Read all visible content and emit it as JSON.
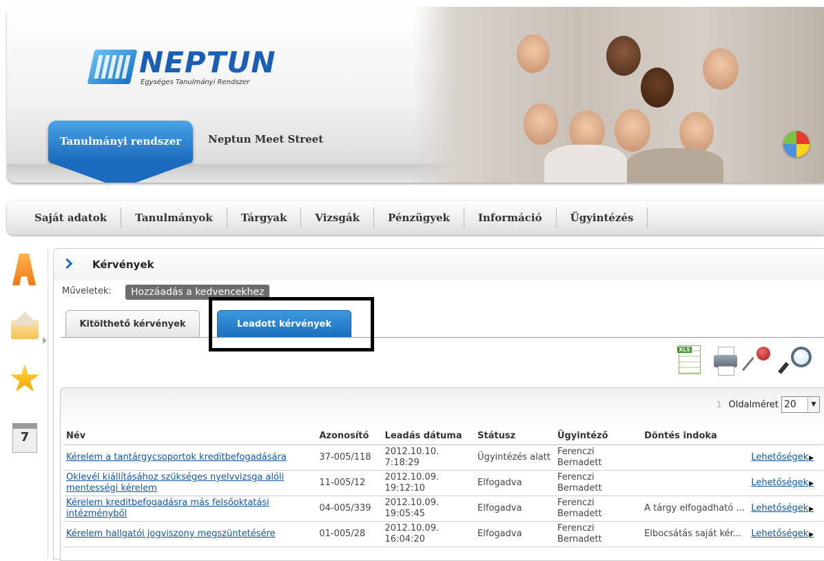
{
  "header": {
    "logo_text": "NEPTUN",
    "logo_subtitle": "Egységes Tanulmányi Rendszer",
    "active_tab": "Tanulmányi rendszer",
    "other_tab": "Neptun Meet Street"
  },
  "nav": {
    "items": [
      "Saját adatok",
      "Tanulmányok",
      "Tárgyak",
      "Vizsgák",
      "Pénzügyek",
      "Információ",
      "Ügyintézés"
    ]
  },
  "sidebar": {
    "calendar_day": "7"
  },
  "page": {
    "title": "Kérvények",
    "operations_label": "Műveletek:",
    "add_favorite": "Hozzáadás a kedvencekhez",
    "tabs": [
      "Kitölthető kérvények",
      "Leadott kérvények"
    ],
    "active_tab_index": 1
  },
  "toolbar": {
    "xls_label": "XLS"
  },
  "grid": {
    "page_number": "1",
    "page_size_label": "Oldalméret",
    "page_size": "20",
    "columns": [
      "Név",
      "Azonosító",
      "Leadás dátuma",
      "Státusz",
      "Ügyintéző",
      "Döntés indoka",
      ""
    ],
    "rows": [
      {
        "name": "Kérelem a tantárgycsoportok kreditbefogadására",
        "id": "37-005/118",
        "date": "2012.10.10. 7:18:29",
        "status": "Ügyintézés alatt",
        "officer": "Ferenczi Bernadett",
        "reason": "",
        "options": "Lehetőségek"
      },
      {
        "name": "Oklevél kiállításához szükséges nyelvvizsga alóli mentességi kérelem",
        "id": "11-005/12",
        "date": "2012.10.09. 19:12:10",
        "status": "Elfogadva",
        "officer": "Ferenczi Bernadett",
        "reason": "",
        "options": "Lehetőségek"
      },
      {
        "name": "Kérelem kreditbefogadásra más felsőoktatási intézményből",
        "id": "04-005/339",
        "date": "2012.10.09. 19:05:45",
        "status": "Elfogadva",
        "officer": "Ferenczi Bernadett",
        "reason": "A tárgy elfogadható ...",
        "options": "Lehetőségek"
      },
      {
        "name": "Kérelem hallgatói jogviszony megszüntetésére",
        "id": "01-005/28",
        "date": "2012.10.09. 16:04:20",
        "status": "Elfogadva",
        "officer": "Ferenczi Bernadett",
        "reason": "Elbocsátás saját kér...",
        "options": "Lehetőségek"
      }
    ]
  }
}
